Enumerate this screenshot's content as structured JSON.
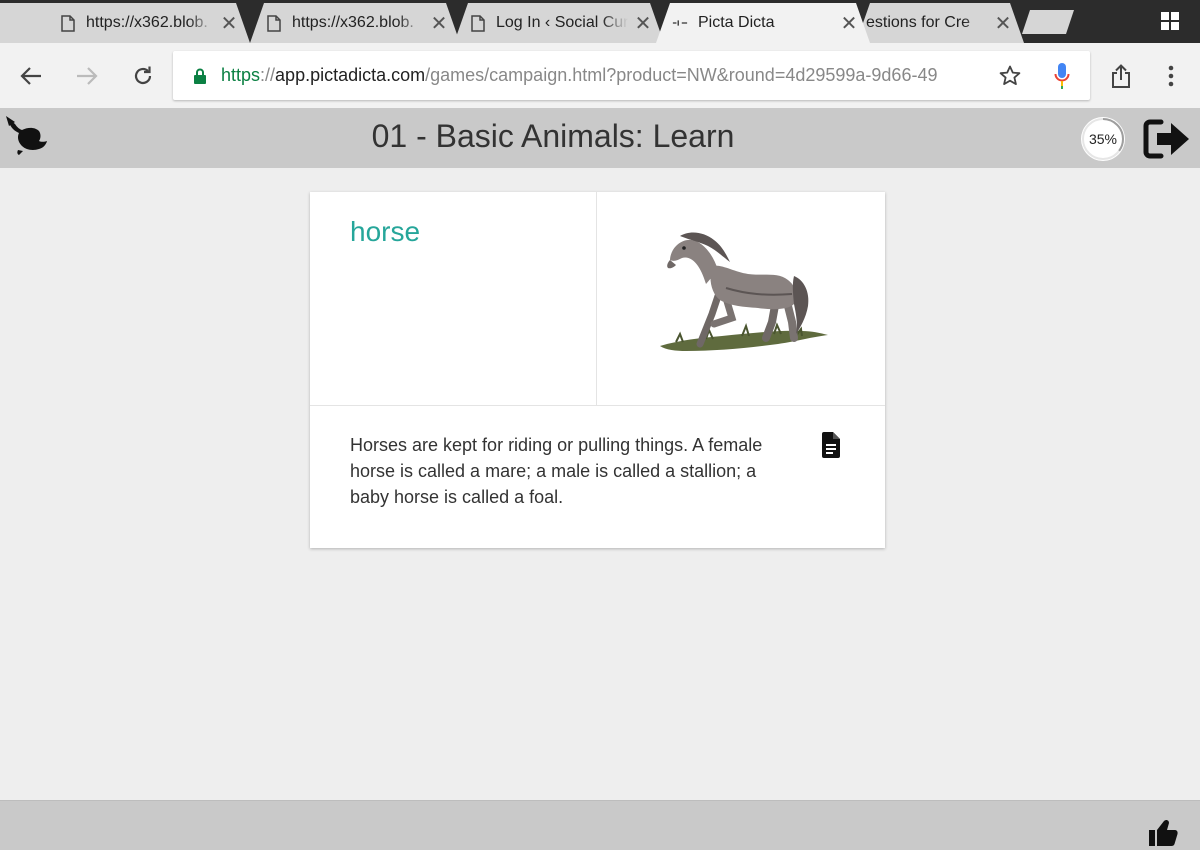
{
  "browser": {
    "tabs": [
      {
        "title": "https://x362.blob."
      },
      {
        "title": "https://x362.blob."
      },
      {
        "title": "Log In ‹ Social Cur"
      },
      {
        "title": "Picta Dicta",
        "active": true
      },
      {
        "title": "estions for Cre"
      }
    ],
    "url": {
      "scheme": "https",
      "separator": "://",
      "host": "app.pictadicta.com",
      "path": "/games/campaign.html?product=NW&round=4d29599a-9d66-49"
    },
    "colors": {
      "secure": "#0b8043",
      "mic_blue": "#4285f4",
      "mic_red": "#ea4335"
    }
  },
  "app": {
    "title": "01 - Basic Animals: Learn",
    "progress_label": "35%",
    "progress_value": 0.35,
    "accent_color": "#26a69a"
  },
  "card": {
    "word": "horse",
    "description": "Horses are kept for riding or pulling things. A female horse is called a mare; a male is called a stallion; a baby horse is called a foal."
  },
  "icons": {
    "logo": "whale-icon",
    "exit": "exit-icon",
    "document": "document-icon",
    "like": "thumbs-up-icon"
  }
}
